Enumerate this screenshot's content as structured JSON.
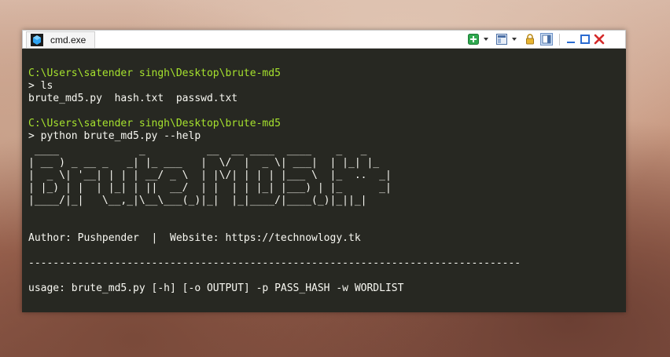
{
  "window": {
    "tab_title": "cmd.exe",
    "icon": "console-app-icon",
    "toolbar_icons": [
      "new-tab-icon",
      "layout-icon",
      "lock-icon",
      "split-view-icon",
      "minimize-icon",
      "maximize-icon",
      "close-icon"
    ]
  },
  "console": {
    "lines": [
      "",
      "C:\\Users\\satender singh\\Desktop\\brute-md5",
      "> ls",
      "brute_md5.py  hash.txt  passwd.txt",
      "",
      "C:\\Users\\satender singh\\Desktop\\brute-md5",
      "> python brute_md5.py --help",
      " ____             _          __  __ ____  ____    _   _",
      "| __ ) _ __ _   _| |_ ___   |  \\/  |  _ \\| ___|  | |_| |_",
      "|  _ \\| '__| | | | __/ _ \\  | |\\/| | | | |___ \\  |_  ..  _|",
      "| |_) | |  | |_| | ||  __/  | |  | | |_| |___) | |_      _|",
      "|____/|_|   \\__,_|\\__\\___(_)|_|  |_|____/|____(_)|_||_|",
      "",
      "",
      "Author: Pushpender  |  Website: https://technowlogy.tk",
      "",
      "--------------------------------------------------------------------------------",
      "",
      "usage: brute_md5.py [-h] [-o OUTPUT] -p PASS_HASH -w WORDLIST"
    ]
  },
  "colors": {
    "console_bg": "#272822",
    "console_fg": "#f8f8f2",
    "path_fg": "#a6e22e"
  }
}
